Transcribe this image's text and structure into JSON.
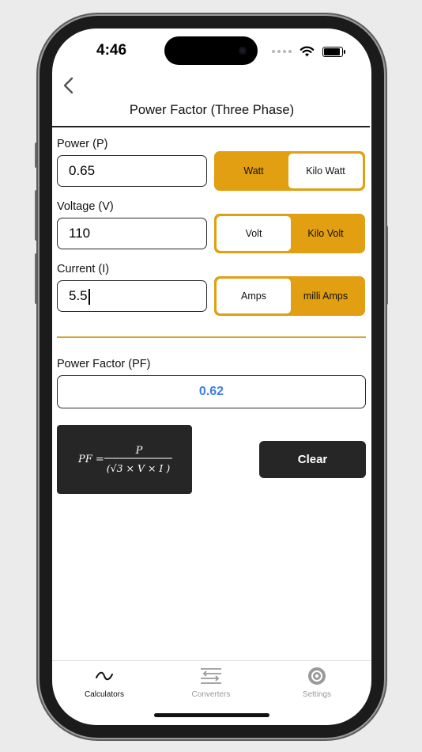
{
  "status_bar": {
    "time": "4:46"
  },
  "header": {
    "title": "Power Factor (Three Phase)"
  },
  "power": {
    "label": "Power (P)",
    "value": "0.65",
    "units": [
      "Watt",
      "Kilo Watt"
    ],
    "selected": "Watt"
  },
  "voltage": {
    "label": "Voltage (V)",
    "value": "110",
    "units": [
      "Volt",
      "Kilo Volt"
    ],
    "selected": "Kilo Volt"
  },
  "current": {
    "label": "Current (I)",
    "value": "5.5",
    "units": [
      "Amps",
      "milli Amps"
    ],
    "selected": "milli Amps"
  },
  "result": {
    "label": "Power Factor (PF)",
    "value": "0.62"
  },
  "formula": {
    "lhs": "PF =",
    "numerator": "P",
    "denominator": "(√3 × V × I )"
  },
  "clear_label": "Clear",
  "tabs": [
    {
      "label": "Calculators",
      "icon": "wave-icon",
      "active": true
    },
    {
      "label": "Converters",
      "icon": "arrows-swap-icon",
      "active": false
    },
    {
      "label": "Settings",
      "icon": "gear-icon",
      "active": false
    }
  ],
  "colors": {
    "accent": "#e19f11",
    "result_text": "#3d7fe0",
    "dark_button": "#262626",
    "tab_inactive": "#9a9a9a"
  }
}
